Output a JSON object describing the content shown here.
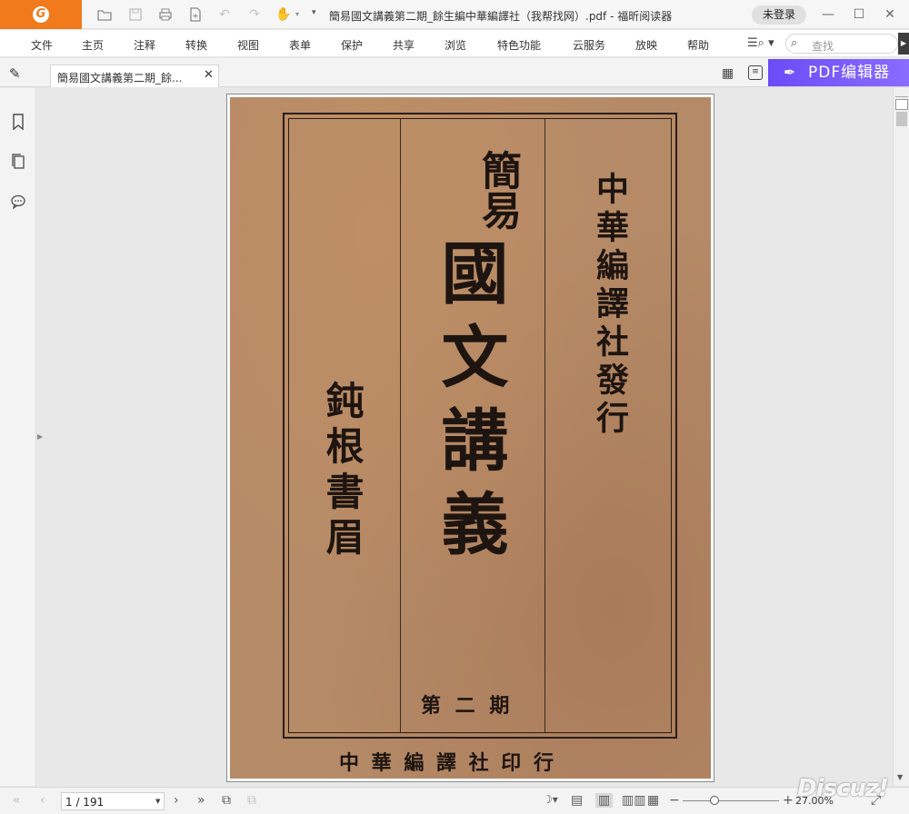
{
  "app": {
    "name": "福昕阅读器",
    "window_title": "簡易國文講義第二期_餘生編中華編譯社（我帮找网）.pdf - 福昕阅读器",
    "login_label": "未登录",
    "logo_glyph": "G"
  },
  "menu": {
    "items": [
      "文件",
      "主页",
      "注释",
      "转换",
      "视图",
      "表单",
      "保护",
      "共享",
      "浏览",
      "特色功能",
      "云服务",
      "放映",
      "帮助"
    ],
    "search_placeholder": "查找"
  },
  "tab": {
    "label": "簡易國文講義第二期_餘...",
    "close_glyph": "✕"
  },
  "pdf_editor_label": "PDF编辑器",
  "document": {
    "title_line1": "簡易",
    "title_main": "國文講義",
    "publisher_vertical": "中華編譯社發行",
    "author_vertical": "鈍根書眉",
    "issue": "第 二 期",
    "bottom_publisher": "中 華 編 譯 社 印 行"
  },
  "status": {
    "page_display": "1 / 191",
    "zoom_percent": "27.00%",
    "zoom_fraction": 0.33
  },
  "watermark": "Discuz!",
  "colors": {
    "accent_orange": "#f07a1c",
    "editor_purple": "#6b4cf6",
    "cover_paper": "#b58a67",
    "ink": "#1e1510"
  },
  "icons": {
    "open": "folder-icon",
    "save": "save-icon",
    "print": "print-icon",
    "new": "new-doc-icon",
    "undo": "undo-icon",
    "redo": "redo-icon",
    "hand": "hand-icon",
    "find": "find-icon",
    "search": "search-icon",
    "pen": "pen-icon",
    "grid": "grid-view-icon",
    "list": "list-view-icon",
    "bookmark": "bookmark-icon",
    "pages": "pages-icon",
    "comments": "comment-icon"
  }
}
